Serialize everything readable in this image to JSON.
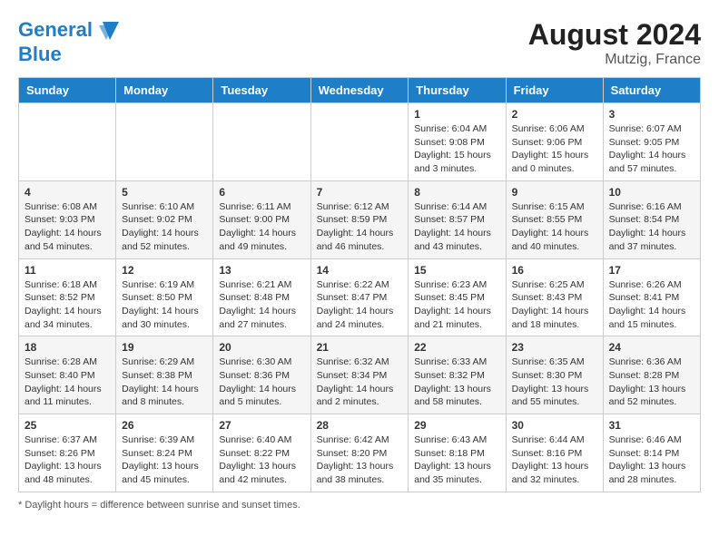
{
  "header": {
    "logo_line1": "General",
    "logo_line2": "Blue",
    "month_year": "August 2024",
    "location": "Mutzig, France"
  },
  "footer": {
    "note": "Daylight hours"
  },
  "weekdays": [
    "Sunday",
    "Monday",
    "Tuesday",
    "Wednesday",
    "Thursday",
    "Friday",
    "Saturday"
  ],
  "weeks": [
    [
      {
        "day": "",
        "info": ""
      },
      {
        "day": "",
        "info": ""
      },
      {
        "day": "",
        "info": ""
      },
      {
        "day": "",
        "info": ""
      },
      {
        "day": "1",
        "info": "Sunrise: 6:04 AM\nSunset: 9:08 PM\nDaylight: 15 hours\nand 3 minutes."
      },
      {
        "day": "2",
        "info": "Sunrise: 6:06 AM\nSunset: 9:06 PM\nDaylight: 15 hours\nand 0 minutes."
      },
      {
        "day": "3",
        "info": "Sunrise: 6:07 AM\nSunset: 9:05 PM\nDaylight: 14 hours\nand 57 minutes."
      }
    ],
    [
      {
        "day": "4",
        "info": "Sunrise: 6:08 AM\nSunset: 9:03 PM\nDaylight: 14 hours\nand 54 minutes."
      },
      {
        "day": "5",
        "info": "Sunrise: 6:10 AM\nSunset: 9:02 PM\nDaylight: 14 hours\nand 52 minutes."
      },
      {
        "day": "6",
        "info": "Sunrise: 6:11 AM\nSunset: 9:00 PM\nDaylight: 14 hours\nand 49 minutes."
      },
      {
        "day": "7",
        "info": "Sunrise: 6:12 AM\nSunset: 8:59 PM\nDaylight: 14 hours\nand 46 minutes."
      },
      {
        "day": "8",
        "info": "Sunrise: 6:14 AM\nSunset: 8:57 PM\nDaylight: 14 hours\nand 43 minutes."
      },
      {
        "day": "9",
        "info": "Sunrise: 6:15 AM\nSunset: 8:55 PM\nDaylight: 14 hours\nand 40 minutes."
      },
      {
        "day": "10",
        "info": "Sunrise: 6:16 AM\nSunset: 8:54 PM\nDaylight: 14 hours\nand 37 minutes."
      }
    ],
    [
      {
        "day": "11",
        "info": "Sunrise: 6:18 AM\nSunset: 8:52 PM\nDaylight: 14 hours\nand 34 minutes."
      },
      {
        "day": "12",
        "info": "Sunrise: 6:19 AM\nSunset: 8:50 PM\nDaylight: 14 hours\nand 30 minutes."
      },
      {
        "day": "13",
        "info": "Sunrise: 6:21 AM\nSunset: 8:48 PM\nDaylight: 14 hours\nand 27 minutes."
      },
      {
        "day": "14",
        "info": "Sunrise: 6:22 AM\nSunset: 8:47 PM\nDaylight: 14 hours\nand 24 minutes."
      },
      {
        "day": "15",
        "info": "Sunrise: 6:23 AM\nSunset: 8:45 PM\nDaylight: 14 hours\nand 21 minutes."
      },
      {
        "day": "16",
        "info": "Sunrise: 6:25 AM\nSunset: 8:43 PM\nDaylight: 14 hours\nand 18 minutes."
      },
      {
        "day": "17",
        "info": "Sunrise: 6:26 AM\nSunset: 8:41 PM\nDaylight: 14 hours\nand 15 minutes."
      }
    ],
    [
      {
        "day": "18",
        "info": "Sunrise: 6:28 AM\nSunset: 8:40 PM\nDaylight: 14 hours\nand 11 minutes."
      },
      {
        "day": "19",
        "info": "Sunrise: 6:29 AM\nSunset: 8:38 PM\nDaylight: 14 hours\nand 8 minutes."
      },
      {
        "day": "20",
        "info": "Sunrise: 6:30 AM\nSunset: 8:36 PM\nDaylight: 14 hours\nand 5 minutes."
      },
      {
        "day": "21",
        "info": "Sunrise: 6:32 AM\nSunset: 8:34 PM\nDaylight: 14 hours\nand 2 minutes."
      },
      {
        "day": "22",
        "info": "Sunrise: 6:33 AM\nSunset: 8:32 PM\nDaylight: 13 hours\nand 58 minutes."
      },
      {
        "day": "23",
        "info": "Sunrise: 6:35 AM\nSunset: 8:30 PM\nDaylight: 13 hours\nand 55 minutes."
      },
      {
        "day": "24",
        "info": "Sunrise: 6:36 AM\nSunset: 8:28 PM\nDaylight: 13 hours\nand 52 minutes."
      }
    ],
    [
      {
        "day": "25",
        "info": "Sunrise: 6:37 AM\nSunset: 8:26 PM\nDaylight: 13 hours\nand 48 minutes."
      },
      {
        "day": "26",
        "info": "Sunrise: 6:39 AM\nSunset: 8:24 PM\nDaylight: 13 hours\nand 45 minutes."
      },
      {
        "day": "27",
        "info": "Sunrise: 6:40 AM\nSunset: 8:22 PM\nDaylight: 13 hours\nand 42 minutes."
      },
      {
        "day": "28",
        "info": "Sunrise: 6:42 AM\nSunset: 8:20 PM\nDaylight: 13 hours\nand 38 minutes."
      },
      {
        "day": "29",
        "info": "Sunrise: 6:43 AM\nSunset: 8:18 PM\nDaylight: 13 hours\nand 35 minutes."
      },
      {
        "day": "30",
        "info": "Sunrise: 6:44 AM\nSunset: 8:16 PM\nDaylight: 13 hours\nand 32 minutes."
      },
      {
        "day": "31",
        "info": "Sunrise: 6:46 AM\nSunset: 8:14 PM\nDaylight: 13 hours\nand 28 minutes."
      }
    ]
  ]
}
